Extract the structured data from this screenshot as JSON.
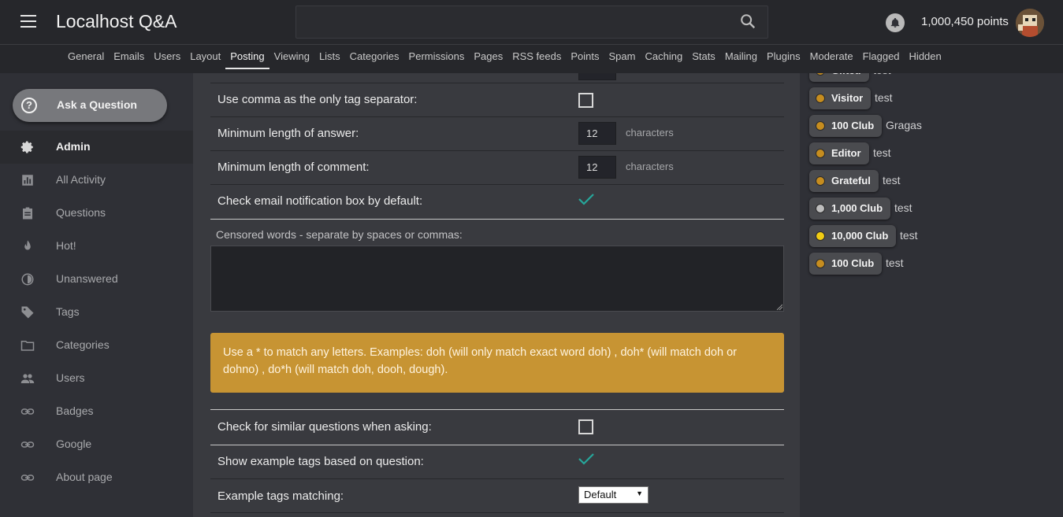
{
  "header": {
    "site_title": "Localhost Q&A",
    "search_value": "",
    "points": "1,000,450 points"
  },
  "admin_tabs": [
    {
      "label": "General"
    },
    {
      "label": "Emails"
    },
    {
      "label": "Users"
    },
    {
      "label": "Layout"
    },
    {
      "label": "Posting",
      "active": true
    },
    {
      "label": "Viewing"
    },
    {
      "label": "Lists"
    },
    {
      "label": "Categories"
    },
    {
      "label": "Permissions"
    },
    {
      "label": "Pages"
    },
    {
      "label": "RSS feeds"
    },
    {
      "label": "Points"
    },
    {
      "label": "Spam"
    },
    {
      "label": "Caching"
    },
    {
      "label": "Stats"
    },
    {
      "label": "Mailing"
    },
    {
      "label": "Plugins"
    },
    {
      "label": "Moderate"
    },
    {
      "label": "Flagged"
    },
    {
      "label": "Hidden"
    }
  ],
  "sidebar": {
    "ask_button": "Ask a Question",
    "items": [
      {
        "label": "Admin",
        "icon": "gear-icon",
        "active": true
      },
      {
        "label": "All Activity",
        "icon": "chart-icon"
      },
      {
        "label": "Questions",
        "icon": "clipboard-icon"
      },
      {
        "label": "Hot!",
        "icon": "fire-icon"
      },
      {
        "label": "Unanswered",
        "icon": "half-circle-icon"
      },
      {
        "label": "Tags",
        "icon": "tag-icon"
      },
      {
        "label": "Categories",
        "icon": "folder-icon"
      },
      {
        "label": "Users",
        "icon": "users-icon"
      },
      {
        "label": "Badges",
        "icon": "link-icon"
      },
      {
        "label": "Google",
        "icon": "link-icon"
      },
      {
        "label": "About page",
        "icon": "link-icon"
      }
    ]
  },
  "settings": {
    "comma_separator": {
      "label": "Use comma as the only tag separator:",
      "checked": false
    },
    "min_answer": {
      "label": "Minimum length of answer:",
      "value": "12",
      "unit": "characters"
    },
    "min_comment": {
      "label": "Minimum length of comment:",
      "value": "12",
      "unit": "characters"
    },
    "email_notify": {
      "label": "Check email notification box by default:",
      "checked": true
    },
    "censored": {
      "label": "Censored words - separate by spaces or commas:",
      "value": ""
    },
    "note": "Use a * to match any letters. Examples: doh (will only match exact word doh) , doh* (will match doh or dohno) , do*h (will match doh, dooh, dough).",
    "similar_questions": {
      "label": "Check for similar questions when asking:",
      "checked": false
    },
    "example_tags": {
      "label": "Show example tags based on question:",
      "checked": true
    },
    "tag_matching": {
      "label": "Example tags matching:",
      "value": "Default"
    }
  },
  "badges": [
    {
      "name": "Gifted",
      "user": "test",
      "color": "#c68d1f"
    },
    {
      "name": "Visitor",
      "user": "test",
      "color": "#c68d1f"
    },
    {
      "name": "100 Club",
      "user": "Gragas",
      "color": "#c68d1f"
    },
    {
      "name": "Editor",
      "user": "test",
      "color": "#c68d1f"
    },
    {
      "name": "Grateful",
      "user": "test",
      "color": "#c68d1f"
    },
    {
      "name": "1,000 Club",
      "user": "test",
      "color": "#bdbdbd"
    },
    {
      "name": "10,000 Club",
      "user": "test",
      "color": "#f1cc13"
    },
    {
      "name": "100 Club",
      "user": "test",
      "color": "#c68d1f"
    }
  ],
  "colors": {
    "accent_check": "#26a69a",
    "note_bg": "#c79433"
  }
}
